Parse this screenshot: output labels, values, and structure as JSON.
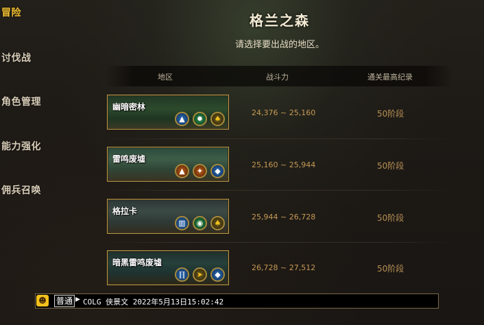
{
  "sidebar": {
    "items": [
      {
        "label": "冒险",
        "active": true
      },
      {
        "label": "讨伐战",
        "active": false
      },
      {
        "label": "角色管理",
        "active": false
      },
      {
        "label": "能力强化",
        "active": false
      },
      {
        "label": "佣兵召唤",
        "active": false
      }
    ]
  },
  "header": {
    "title": "格兰之森",
    "subtitle": "请选择要出战的地区。"
  },
  "table": {
    "columns": [
      "地区",
      "战斗力",
      "通关最高纪录"
    ],
    "rows": [
      {
        "name": "幽暗密林",
        "power": "24,376 ~ 25,160",
        "record": "50阶段",
        "icons": [
          "blue-mountain-icon",
          "green-gear-icon",
          "gold-spade-icon"
        ]
      },
      {
        "name": "雷鸣废墟",
        "power": "25,160 ~ 25,944",
        "record": "50阶段",
        "icons": [
          "orange-mountain-icon",
          "orange-torch-icon",
          "blue-drop-icon"
        ]
      },
      {
        "name": "格拉卡",
        "power": "25,944 ~ 26,728",
        "record": "50阶段",
        "icons": [
          "blue-tower-icon",
          "green-eye-icon",
          "gold-spade-icon"
        ]
      },
      {
        "name": "暗黑雷鸣废墟",
        "power": "26,728 ~ 27,512",
        "record": "50阶段",
        "icons": [
          "blue-pillar-icon",
          "gold-arrow-icon",
          "blue-drop-icon"
        ]
      }
    ]
  },
  "chat": {
    "channel": "普通",
    "message": "COLG 侠景文 2022年5月13日15:02:42"
  },
  "colors": {
    "active_menu": "#f5c232",
    "power_text": "#c79a55",
    "banner_border": "#b89a4a"
  }
}
